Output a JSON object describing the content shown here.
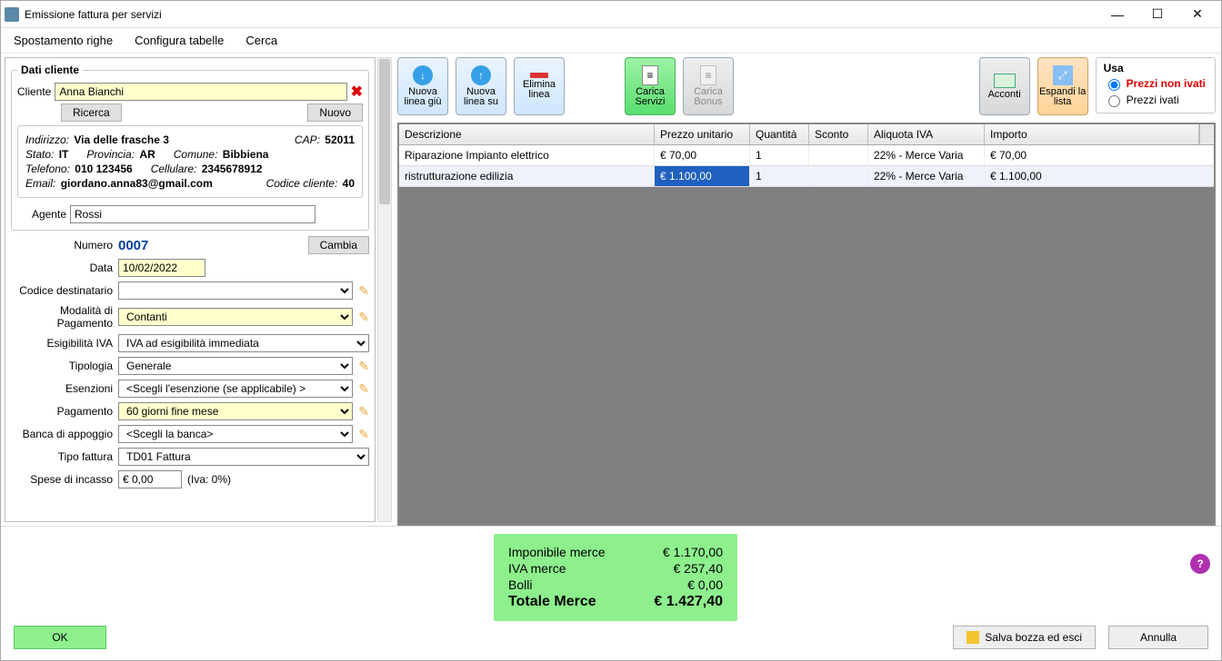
{
  "window": {
    "title": "Emissione fattura per servizi"
  },
  "menu": {
    "spostamento": "Spostamento righe",
    "configura": "Configura tabelle",
    "cerca": "Cerca"
  },
  "group_title": "Dati cliente",
  "client": {
    "label": "Cliente",
    "value": "Anna Bianchi",
    "ricerca": "Ricerca",
    "nuovo": "Nuovo",
    "address_k": "Indirizzo:",
    "address_v": "Via delle frasche 3",
    "cap_k": "CAP:",
    "cap_v": "52011",
    "state_k": "Stato:",
    "state_v": "IT",
    "prov_k": "Provincia:",
    "prov_v": "AR",
    "com_k": "Comune:",
    "com_v": "Bibbiena",
    "tel_k": "Telefono:",
    "tel_v": "010 123456",
    "cell_k": "Cellulare:",
    "cell_v": "2345678912",
    "email_k": "Email:",
    "email_v": "giordano.anna83@gmail.com",
    "code_k": "Codice cliente:",
    "code_v": "40",
    "agent_k": "Agente",
    "agent_v": "Rossi"
  },
  "form": {
    "numero_k": "Numero",
    "numero_v": "0007",
    "cambia": "Cambia",
    "data_k": "Data",
    "data_v": "10/02/2022",
    "dest_k": "Codice destinatario",
    "dest_v": "",
    "pag_mod_k": "Modalità di Pagamento",
    "pag_mod_v": "Contanti",
    "esig_k": "Esigibilità IVA",
    "esig_v": "IVA ad esigibilità immediata",
    "tipologia_k": "Tipologia",
    "tipologia_v": "Generale",
    "esenz_k": "Esenzioni",
    "esenz_v": "<Scegli l'esenzione (se applicabile) >",
    "pag_k": "Pagamento",
    "pag_v": "60 giorni fine mese",
    "bank_k": "Banca di appoggio",
    "bank_v": "<Scegli la banca>",
    "tipo_k": "Tipo fattura",
    "tipo_v": "TD01 Fattura",
    "spese_k": "Spese di incasso",
    "spese_v": "€ 0,00",
    "spese_iva": "(Iva: 0%)"
  },
  "toolbar": {
    "nuova_giu": "Nuova linea giù",
    "nuova_su": "Nuova linea su",
    "elimina": "Elimina linea",
    "carica_servizi": "Carica Servizi",
    "carica_bonus": "Carica Bonus",
    "acconti": "Acconti",
    "espandi": "Espandi la lista"
  },
  "usa": {
    "title": "Usa",
    "opt1": "Prezzi non ivati",
    "opt2": "Prezzi ivati",
    "selected": 0
  },
  "grid": {
    "headers": [
      "Descrizione",
      "Prezzo unitario",
      "Quantità",
      "Sconto",
      "Aliquota IVA",
      "Importo"
    ],
    "rows": [
      {
        "desc": "Riparazione Impianto elettrico",
        "prezzo": "€ 70,00",
        "qta": "1",
        "sconto": "",
        "iva": "22% - Merce Varia",
        "imp": "€ 70,00"
      },
      {
        "desc": "ristrutturazione edilizia",
        "prezzo": "€ 1.100,00",
        "qta": "1",
        "sconto": "",
        "iva": "22% - Merce Varia",
        "imp": "€ 1.100,00"
      }
    ]
  },
  "totals": {
    "imponibile_k": "Imponibile merce",
    "imponibile_v": "€ 1.170,00",
    "iva_k": "IVA merce",
    "iva_v": "€ 257,40",
    "bolli_k": "Bolli",
    "bolli_v": "€ 0,00",
    "tot_k": "Totale Merce",
    "tot_v": "€ 1.427,40"
  },
  "buttons": {
    "ok": "OK",
    "save": "Salva bozza ed esci",
    "cancel": "Annulla"
  }
}
